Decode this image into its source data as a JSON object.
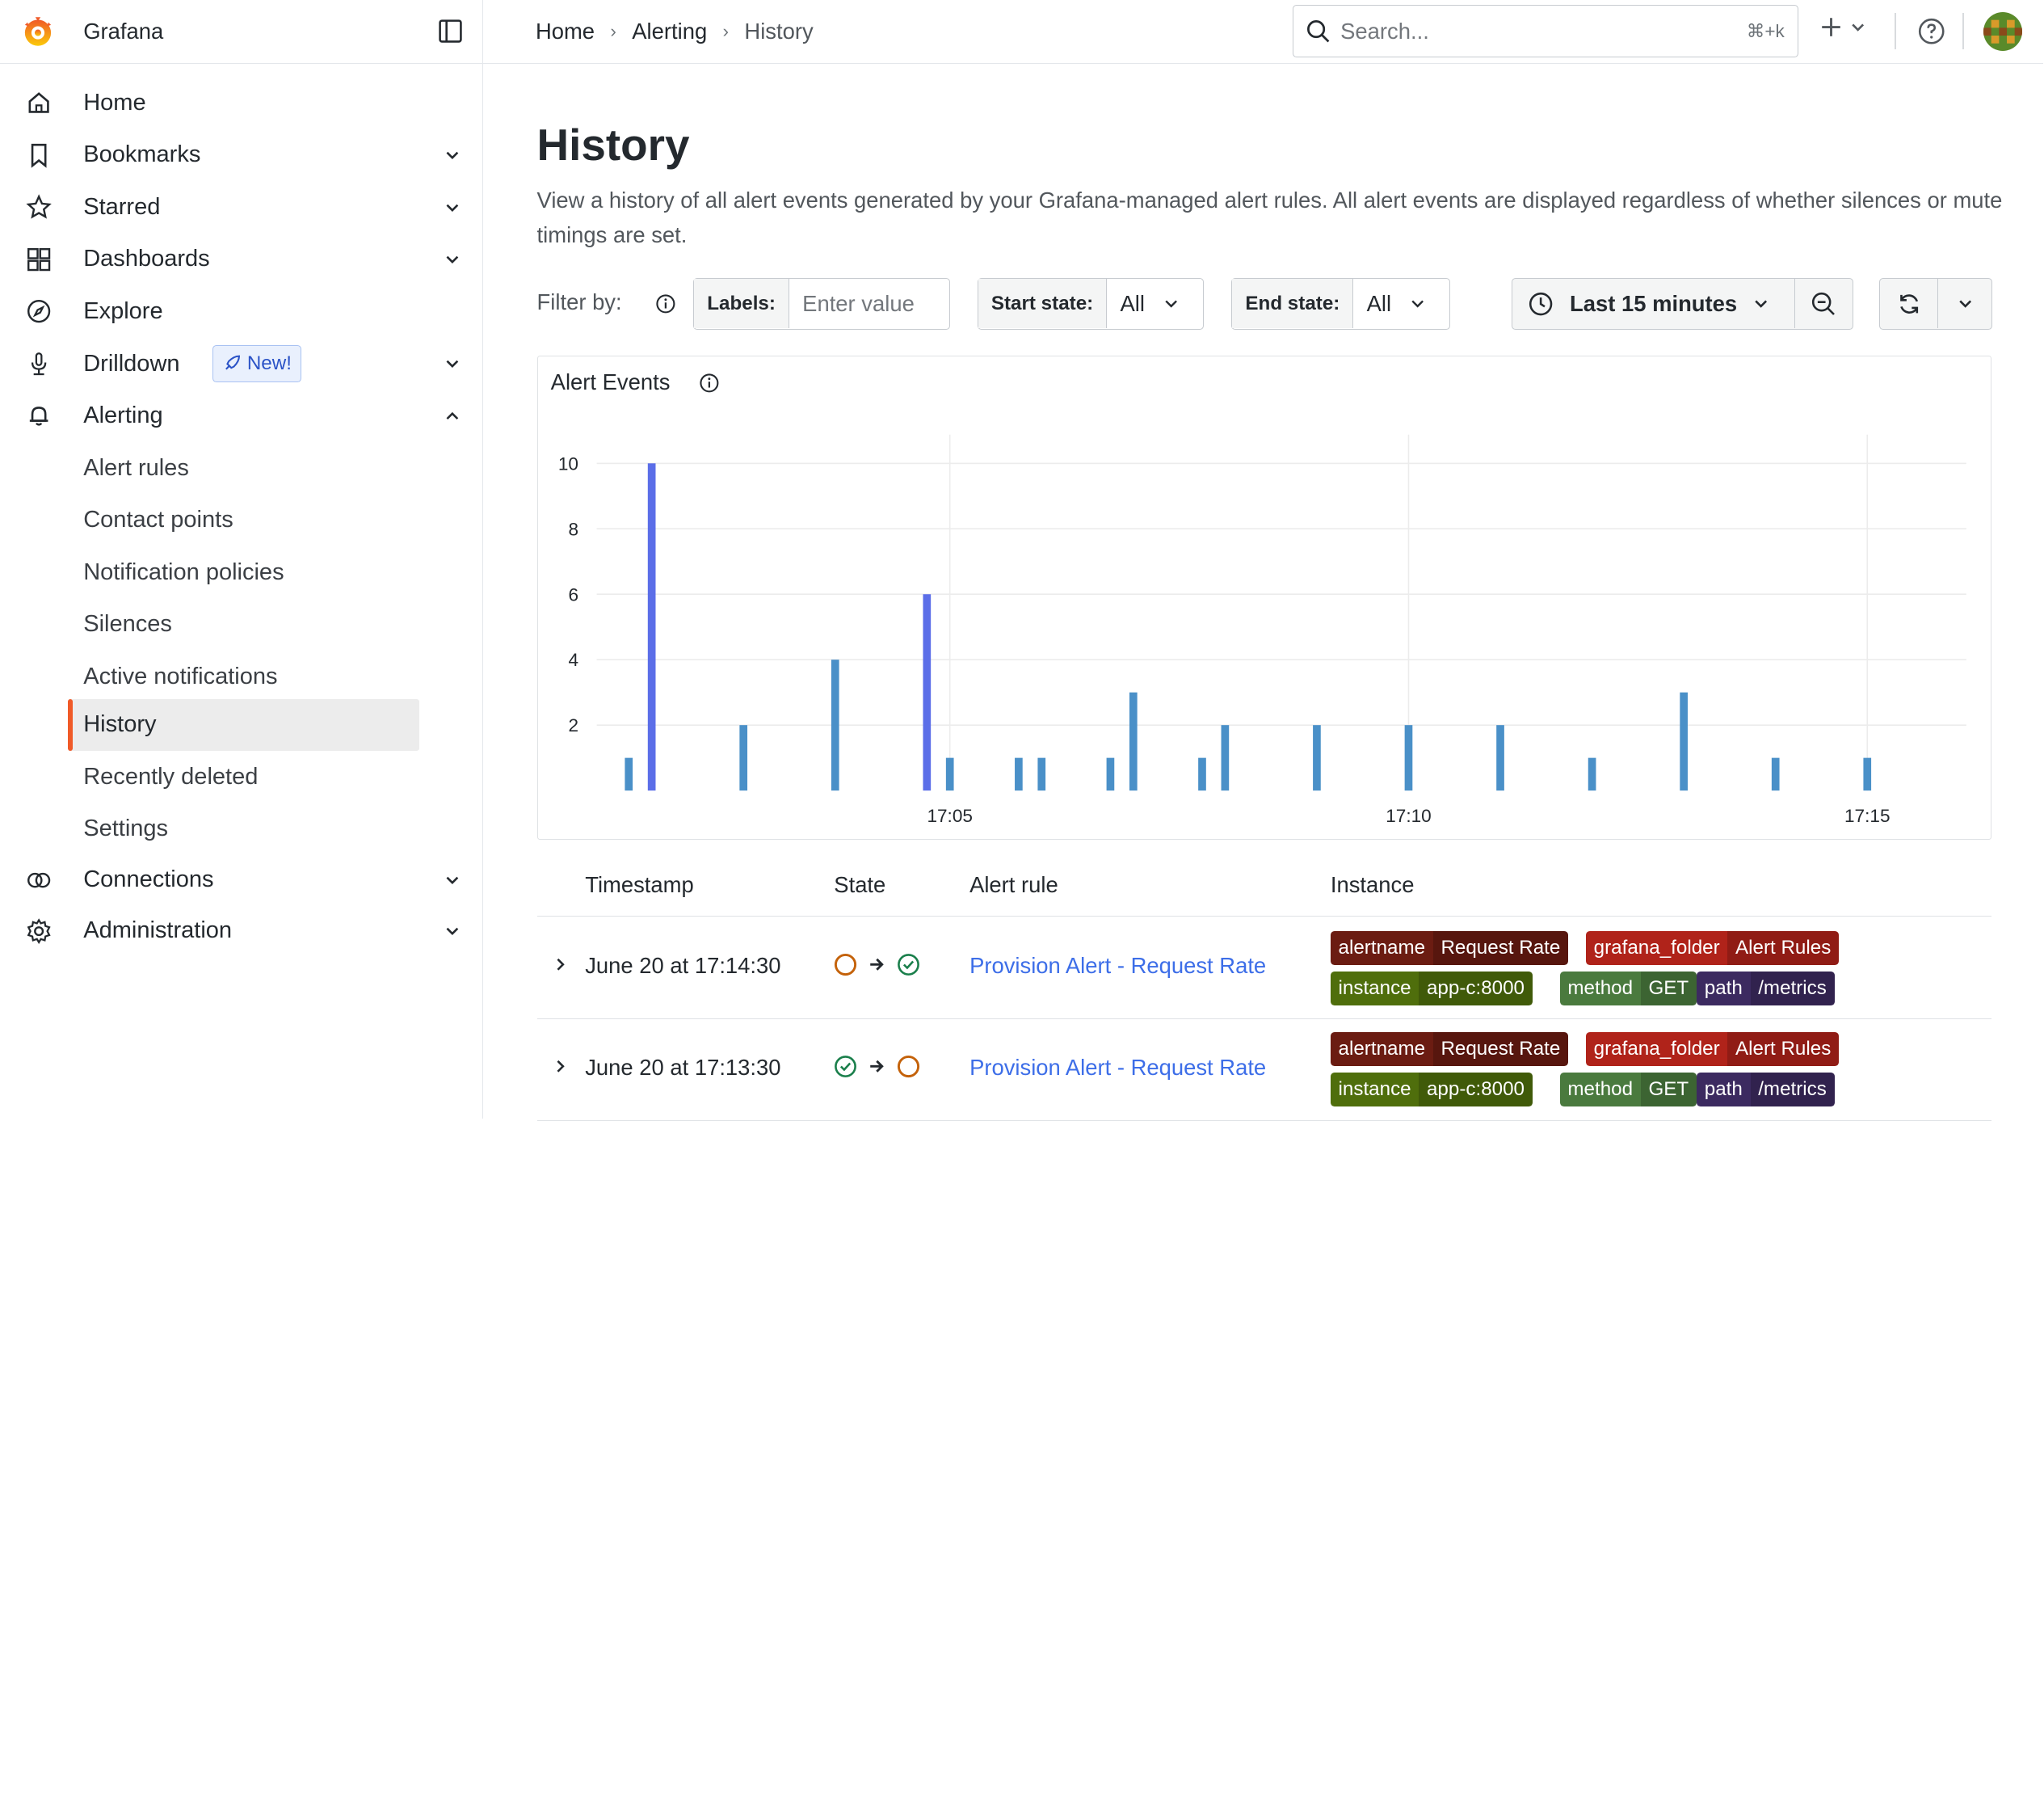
{
  "app": {
    "name": "Grafana"
  },
  "breadcrumb": [
    "Home",
    "Alerting",
    "History"
  ],
  "search": {
    "placeholder": "Search...",
    "shortcut": "⌘+k"
  },
  "sidebar": {
    "items": [
      {
        "label": "Home",
        "icon": "home-icon"
      },
      {
        "label": "Bookmarks",
        "icon": "bookmark-icon"
      },
      {
        "label": "Starred",
        "icon": "star-icon"
      },
      {
        "label": "Dashboards",
        "icon": "dashboards-icon"
      },
      {
        "label": "Explore",
        "icon": "compass-icon"
      },
      {
        "label": "Drilldown",
        "icon": "drilldown-icon",
        "badge": "New!"
      },
      {
        "label": "Alerting",
        "icon": "bell-icon"
      },
      {
        "label": "Connections",
        "icon": "connections-icon"
      },
      {
        "label": "Administration",
        "icon": "cog-icon"
      }
    ],
    "alerting_sub": [
      "Alert rules",
      "Contact points",
      "Notification policies",
      "Silences",
      "Active notifications",
      "History",
      "Recently deleted",
      "Settings"
    ],
    "active": "History"
  },
  "page": {
    "title": "History",
    "description": "View a history of all alert events generated by your Grafana-managed alert rules. All alert events are displayed regardless of whether silences or mute timings are set."
  },
  "filters": {
    "filter_by": "Filter by:",
    "labels_label": "Labels:",
    "labels_placeholder": "Enter value",
    "start_state_label": "Start state:",
    "start_state_value": "All",
    "end_state_label": "End state:",
    "end_state_value": "All",
    "time_range": "Last 15 minutes"
  },
  "panel": {
    "title": "Alert Events"
  },
  "chart_data": {
    "type": "bar",
    "title": "Alert Events",
    "ylim": [
      0,
      10
    ],
    "y_ticks": [
      2,
      4,
      6,
      8,
      10
    ],
    "x_ticks": [
      "17:05",
      "17:10",
      "17:15"
    ],
    "points": [
      {
        "t": "17:01:30",
        "v": 1
      },
      {
        "t": "17:01:45",
        "v": 10
      },
      {
        "t": "17:02:45",
        "v": 2
      },
      {
        "t": "17:03:45",
        "v": 4
      },
      {
        "t": "17:04:45",
        "v": 6
      },
      {
        "t": "17:05:00",
        "v": 1
      },
      {
        "t": "17:05:45",
        "v": 1
      },
      {
        "t": "17:06:00",
        "v": 1
      },
      {
        "t": "17:06:45",
        "v": 1
      },
      {
        "t": "17:07:00",
        "v": 3
      },
      {
        "t": "17:07:45",
        "v": 1
      },
      {
        "t": "17:08:00",
        "v": 2
      },
      {
        "t": "17:09:00",
        "v": 2
      },
      {
        "t": "17:10:00",
        "v": 2
      },
      {
        "t": "17:11:00",
        "v": 2
      },
      {
        "t": "17:12:00",
        "v": 1
      },
      {
        "t": "17:13:00",
        "v": 3
      },
      {
        "t": "17:14:00",
        "v": 1
      },
      {
        "t": "17:15:00",
        "v": 1
      }
    ],
    "colors": {
      "high": "#5b6ee8",
      "normal": "#4a90c8"
    }
  },
  "table": {
    "headers": [
      "Timestamp",
      "State",
      "Alert rule",
      "Instance"
    ],
    "rows": [
      {
        "timestamp": "June 20 at 17:14:30",
        "from_state": "pending",
        "to_state": "normal",
        "rule": "Provision Alert - Request Rate",
        "labels": [
          {
            "key": "alertname",
            "value": "Request Rate",
            "color": "#6b1c12"
          },
          {
            "key": "grafana_folder",
            "value": "Alert Rules",
            "color": "#b0231a"
          },
          {
            "key": "instance",
            "value": "app-c:8000",
            "color": "#4f6e0c"
          },
          {
            "key": "method",
            "value": "GET",
            "color": "#4a7a3e"
          },
          {
            "key": "path",
            "value": "/metrics",
            "color": "#3c2a60"
          }
        ]
      },
      {
        "timestamp": "June 20 at 17:13:30",
        "from_state": "normal",
        "to_state": "pending",
        "rule": "Provision Alert - Request Rate",
        "labels": [
          {
            "key": "alertname",
            "value": "Request Rate",
            "color": "#6b1c12"
          },
          {
            "key": "grafana_folder",
            "value": "Alert Rules",
            "color": "#b0231a"
          },
          {
            "key": "instance",
            "value": "app-c:8000",
            "color": "#4f6e0c"
          },
          {
            "key": "method",
            "value": "GET",
            "color": "#4a7a3e"
          },
          {
            "key": "path",
            "value": "/metrics",
            "color": "#3c2a60"
          }
        ]
      }
    ]
  }
}
